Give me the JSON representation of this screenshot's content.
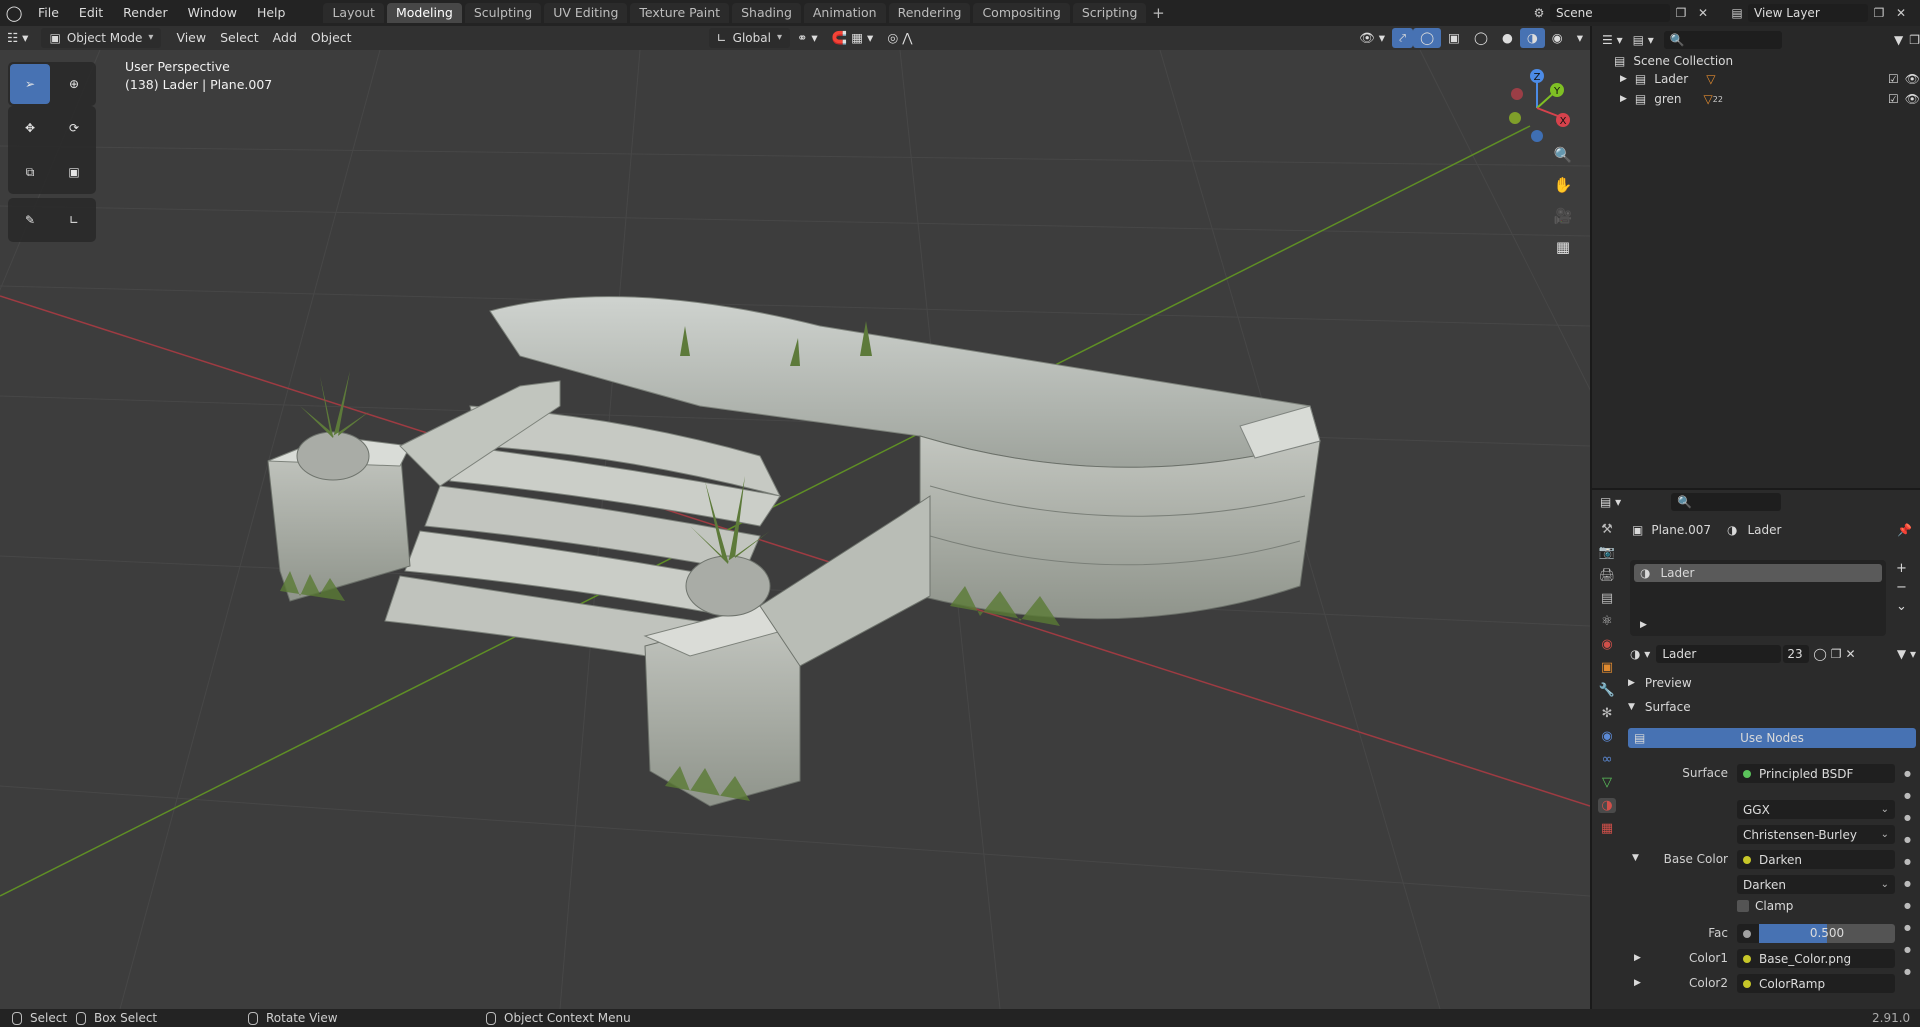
{
  "topbar": {
    "menus": [
      "File",
      "Edit",
      "Render",
      "Window",
      "Help"
    ],
    "workspaces": [
      "Layout",
      "Modeling",
      "Sculpting",
      "UV Editing",
      "Texture Paint",
      "Shading",
      "Animation",
      "Rendering",
      "Compositing",
      "Scripting"
    ],
    "active_workspace": "Modeling",
    "add_tab": "+",
    "scene": "Scene",
    "view_layer": "View Layer"
  },
  "viewport": {
    "mode": "Object Mode",
    "menus": [
      "View",
      "Select",
      "Add",
      "Object"
    ],
    "transform_orientation": "Global",
    "perspective": "User Perspective",
    "active_info": "(138) Lader | Plane.007",
    "gizmo": {
      "z": "Z",
      "y": "Y",
      "x": "X"
    }
  },
  "outliner": {
    "root": "Scene Collection",
    "items": [
      {
        "label": "Lader"
      },
      {
        "label": "gren",
        "badge": "22"
      }
    ]
  },
  "properties": {
    "breadcrumb_object": "Plane.007",
    "breadcrumb_material": "Lader",
    "slot": "Lader",
    "material_name": "Lader",
    "material_users": "23",
    "panel_preview": "Preview",
    "panel_surface": "Surface",
    "use_nodes": "Use Nodes",
    "surface_label": "Surface",
    "surface_value": "Principled BSDF",
    "distribution": "GGX",
    "subsurface": "Christensen-Burley",
    "base_color_label": "Base Color",
    "base_color_value": "Darken",
    "blend_mode": "Darken",
    "clamp_label": "Clamp",
    "fac_label": "Fac",
    "fac_value": "0.500",
    "fac_fraction": 0.5,
    "color1_label": "Color1",
    "color1_value": "Base_Color.png",
    "color2_label": "Color2",
    "color2_value": "ColorRamp"
  },
  "statusbar": {
    "select": "Select",
    "box_select": "Box Select",
    "rotate_view": "Rotate View",
    "context_menu": "Object Context Menu",
    "version": "2.91.0"
  },
  "colors": {
    "accent": "#4772b3",
    "axis_x": "#d6424c",
    "axis_y": "#7fc024",
    "axis_z": "#4c8be6",
    "socket_yellow": "#c7c729",
    "socket_green": "#5bc35b",
    "socket_gray": "#a1a1a1"
  }
}
